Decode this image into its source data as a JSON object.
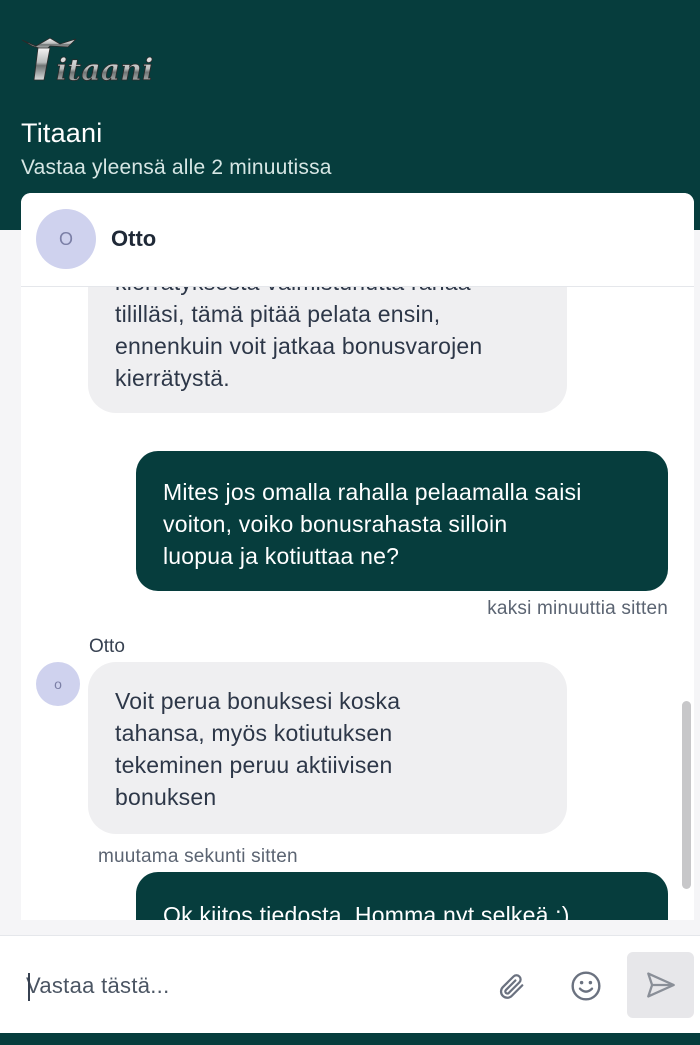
{
  "header": {
    "logo_text": "Titaani",
    "title": "Titaani",
    "subtitle": "Vastaa yleensä alle 2 minuutissa"
  },
  "agent": {
    "initial": "O",
    "name": "Otto"
  },
  "messages": [
    {
      "direction": "in",
      "lines": [
        "kierrätyksestä valmistunutta rahaa",
        "tililläsi, tämä pitää pelata ensin,",
        "ennenkuin voit jatkaa bonusvarojen",
        "kierrätystä."
      ]
    },
    {
      "direction": "out",
      "lines": [
        "Mites jos omalla rahalla pelaamalla saisi",
        "voiton, voiko bonusrahasta silloin",
        "luopua ja kotiuttaa ne?"
      ],
      "timestamp": "kaksi minuuttia sitten"
    },
    {
      "direction": "in",
      "sender": "Otto",
      "avatar_initial": "o",
      "lines": [
        "Voit perua bonuksesi koska",
        "tahansa, myös kotiutuksen",
        "tekeminen peruu aktiivisen",
        "bonuksen"
      ],
      "timestamp": "muutama sekunti sitten"
    },
    {
      "direction": "out",
      "lines": [
        "Ok kiitos tiedosta. Homma nyt selkeä :)"
      ]
    }
  ],
  "composer": {
    "placeholder": "Vastaa tästä...",
    "value": ""
  },
  "icons": {
    "attach": "paperclip-icon",
    "emoji": "smiley-icon",
    "send": "send-arrow-icon"
  },
  "colors": {
    "brand": "#063d3d",
    "incoming_bubble": "#efeff1",
    "avatar": "#cfd2ee"
  }
}
